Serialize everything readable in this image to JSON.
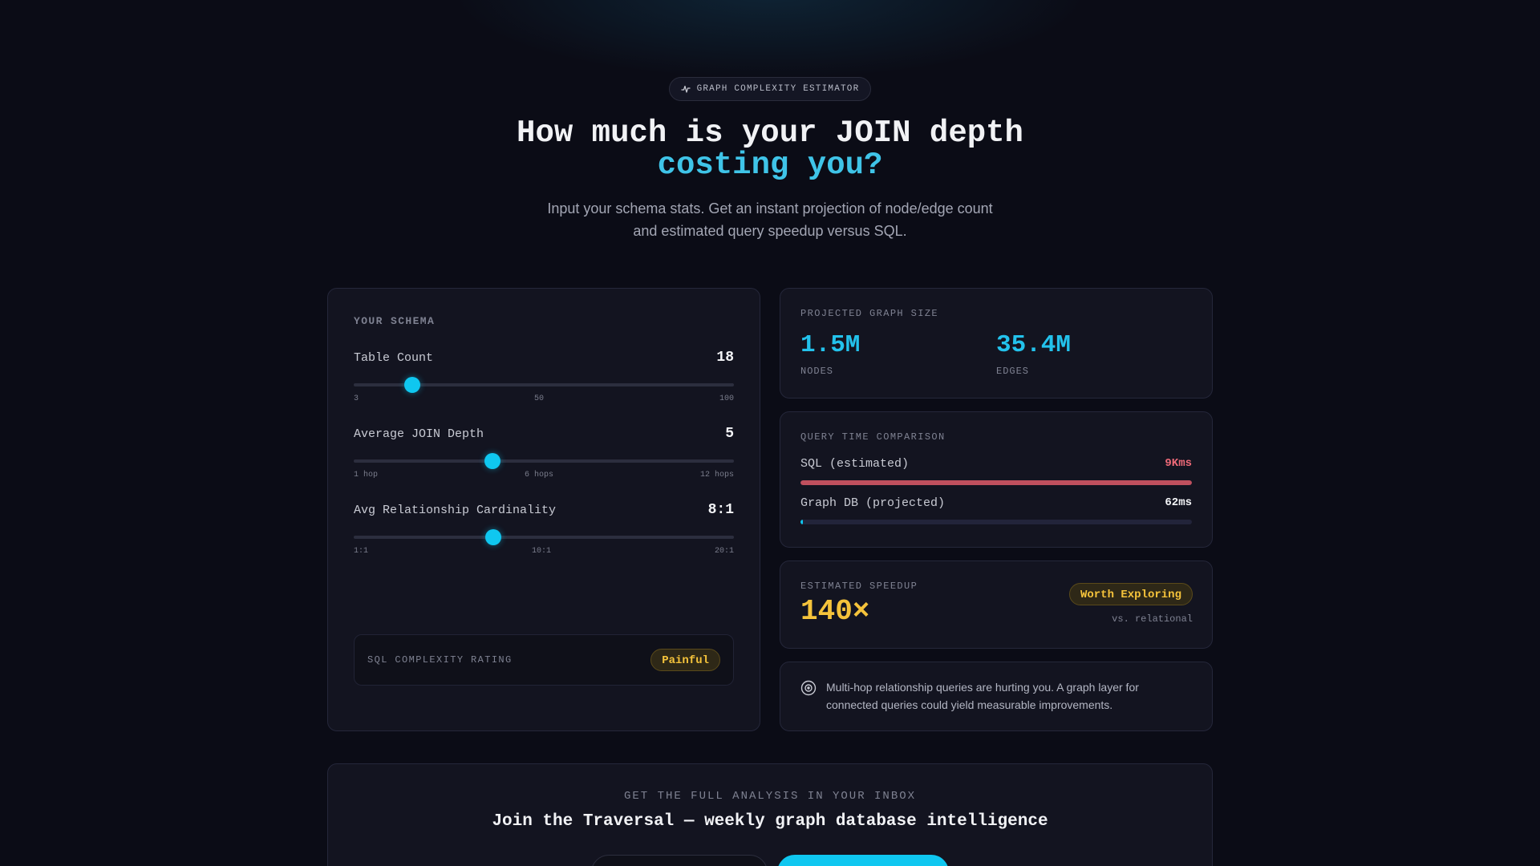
{
  "hero": {
    "badge": "GRAPH COMPLEXITY ESTIMATOR",
    "title_line1": "How much is your JOIN depth",
    "title_line2": "costing you?",
    "subtitle": "Input your schema stats. Get an instant projection of node/edge count and estimated query speedup versus SQL."
  },
  "schema": {
    "label": "YOUR SCHEMA",
    "sliders": [
      {
        "name": "Table Count",
        "value": "18",
        "fraction": 0.155,
        "ticks": [
          "3",
          "50",
          "100"
        ]
      },
      {
        "name": "Average JOIN Depth",
        "value": "5",
        "fraction": 0.364,
        "ticks": [
          "1 hop",
          "6 hops",
          "12 hops"
        ]
      },
      {
        "name": "Avg Relationship Cardinality",
        "value": "8:1",
        "fraction": 0.368,
        "ticks": [
          "1:1",
          "10:1",
          "20:1"
        ]
      }
    ],
    "rating": {
      "label": "SQL COMPLEXITY RATING",
      "value": "Painful"
    }
  },
  "graph_size": {
    "label": "PROJECTED GRAPH SIZE",
    "nodes_value": "1.5M",
    "nodes_label": "NODES",
    "edges_value": "35.4M",
    "edges_label": "EDGES"
  },
  "query_time": {
    "label": "QUERY TIME COMPARISON",
    "sql_label": "SQL (estimated)",
    "sql_value": "9Kms",
    "sql_fraction": 1.0,
    "graph_label": "Graph DB (projected)",
    "graph_value": "62ms",
    "graph_fraction": 0.007
  },
  "speedup": {
    "label": "ESTIMATED SPEEDUP",
    "value": "140×",
    "badge": "Worth Exploring",
    "note": "vs. relational"
  },
  "insight": {
    "icon": "target-icon",
    "text": "Multi-hop relationship queries are hurting you. A graph layer for connected queries could yield measurable improvements."
  },
  "newsletter": {
    "label": "GET THE FULL ANALYSIS IN YOUR INBOX",
    "title": "Join the Traversal — weekly graph database intelligence"
  },
  "colors": {
    "accent": "#0fc7f0",
    "sql_red": "#c0505e",
    "warning_yellow": "#f5c33b"
  }
}
